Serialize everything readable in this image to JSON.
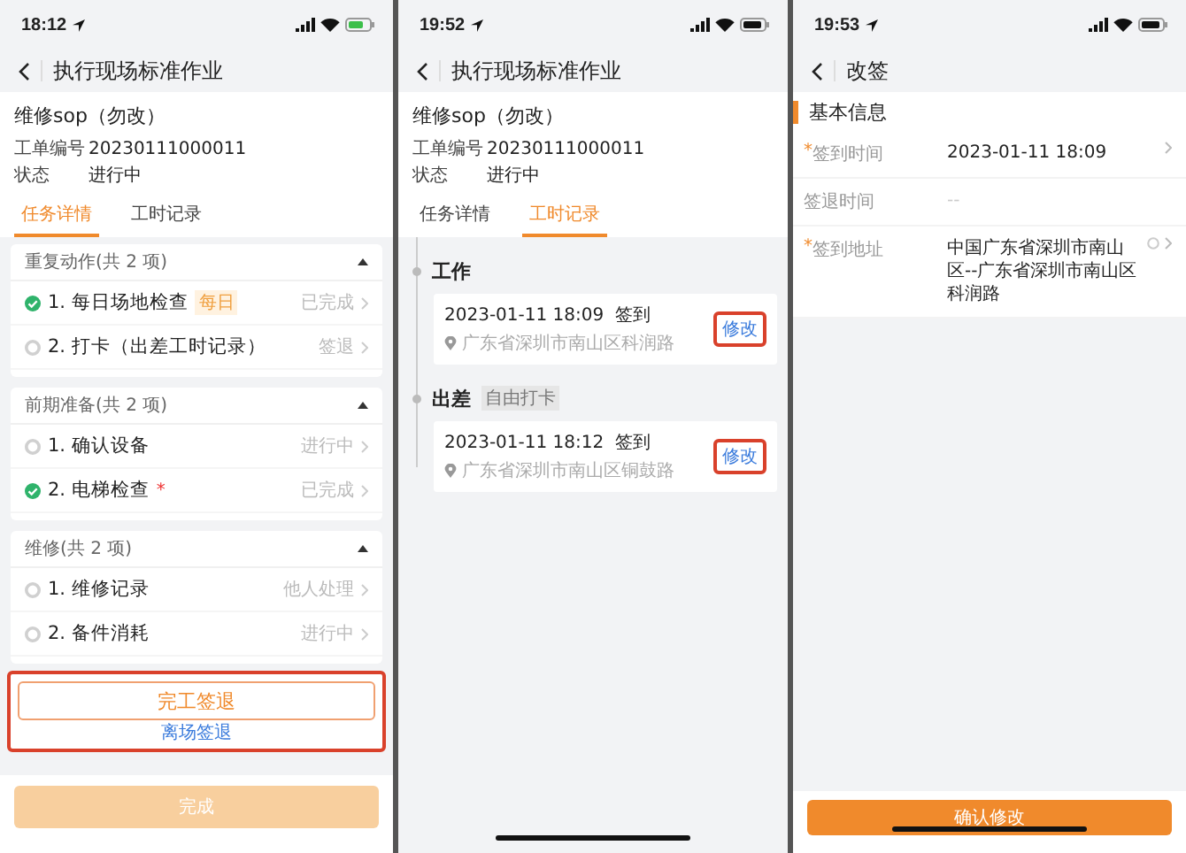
{
  "screens": [
    {
      "kind": "tasks",
      "time": "18:12",
      "charging": true,
      "title": "执行现场标准作业",
      "order": {
        "name": "维修sop（勿改）",
        "fields": [
          {
            "label": "工单编号",
            "value": "20230111000011"
          },
          {
            "label": "状态",
            "value": "进行中"
          }
        ]
      },
      "tabs": [
        {
          "label": "任务详情",
          "selected": true
        },
        {
          "label": "工时记录",
          "selected": false
        }
      ],
      "groups": [
        {
          "title": "重复动作(共 2 项)",
          "items": [
            {
              "label": "1. 每日场地检查",
              "tag": "每日",
              "done": true,
              "status": "已完成"
            },
            {
              "label": "2. 打卡（出差工时记录）",
              "done": false,
              "status": "签退"
            }
          ]
        },
        {
          "title": "前期准备(共 2 项)",
          "items": [
            {
              "label": "1. 确认设备",
              "done": false,
              "status": "进行中"
            },
            {
              "label": "2. 电梯检查",
              "mark": "*",
              "done": true,
              "status": "已完成"
            }
          ]
        },
        {
          "title": "维修(共 2 项)",
          "items": [
            {
              "label": "1. 维修记录",
              "done": false,
              "status": "他人处理"
            },
            {
              "label": "2. 备件消耗",
              "done": false,
              "status": "进行中"
            }
          ]
        }
      ],
      "checkout": {
        "button": "完工签退",
        "link": "离场签退",
        "highlighted": true
      },
      "finish": {
        "label": "完成",
        "disabled": true
      }
    },
    {
      "kind": "records",
      "time": "19:52",
      "charging": false,
      "title": "执行现场标准作业",
      "order": {
        "name": "维修sop（勿改）",
        "fields": [
          {
            "label": "工单编号",
            "value": "20230111000011"
          },
          {
            "label": "状态",
            "value": "进行中"
          }
        ]
      },
      "tabs": [
        {
          "label": "任务详情",
          "selected": false
        },
        {
          "label": "工时记录",
          "selected": true
        }
      ],
      "sections": [
        {
          "title": "工作",
          "records": [
            {
              "datetime": "2023-01-11 18:09",
              "action": "签到",
              "address": "广东省深圳市南山区科润路",
              "button": "修改",
              "highlighted": true
            }
          ]
        },
        {
          "title": "出差",
          "tag": "自由打卡",
          "records": [
            {
              "datetime": "2023-01-11 18:12",
              "action": "签到",
              "address": "广东省深圳市南山区铜鼓路",
              "button": "修改",
              "highlighted": true
            }
          ]
        }
      ]
    },
    {
      "kind": "edit",
      "time": "19:53",
      "charging": false,
      "title": "改签",
      "section": "基本信息",
      "fields": [
        {
          "label": "签到时间",
          "mark": "*",
          "value": "2023-01-11 18:09",
          "muted": false,
          "chevron": true,
          "clearable": false
        },
        {
          "label": "签退时间",
          "value": "--",
          "muted": true,
          "chevron": false,
          "clearable": false
        },
        {
          "label": "签到地址",
          "mark": "*",
          "value": "中国广东省深圳市南山区--广东省深圳市南山区科润路",
          "muted": false,
          "chevron": true,
          "clearable": true
        }
      ],
      "confirm": "确认修改"
    }
  ]
}
